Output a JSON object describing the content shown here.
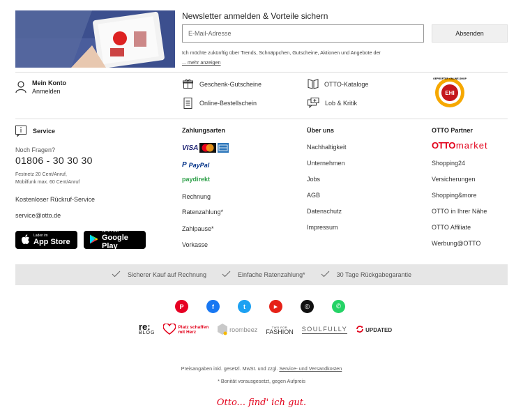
{
  "newsletter": {
    "title": "Newsletter anmelden & Vorteile sichern",
    "email_placeholder": "E-Mail-Adresse",
    "submit_label": "Absenden",
    "consent_text": "Ich möchte zukünftig über Trends, Schnäppchen, Gutscheine, Aktionen und Angebote der",
    "more_label": "... mehr anzeigen"
  },
  "account": {
    "title": "Mein Konto",
    "login": "Anmelden",
    "links": [
      {
        "label": "Geschenk-Gutscheine",
        "icon": "gift-icon"
      },
      {
        "label": "Online-Bestellschein",
        "icon": "document-icon"
      },
      {
        "label": "OTTO-Kataloge",
        "icon": "catalog-icon"
      },
      {
        "label": "Lob & Kritik",
        "icon": "feedback-icon"
      }
    ],
    "seal_text": "GEPRÜFTER ONLINE-SHOP",
    "seal_label": "EHI"
  },
  "service": {
    "title": "Service",
    "question": "Noch Fragen?",
    "phone": "01806 - 30 30 30",
    "cost_line1": "Festnetz 20 Cent/Anruf,",
    "cost_line2": "Mobilfunk max. 60 Cent/Anruf",
    "callback": "Kostenloser Rückruf-Service",
    "email": "service@otto.de",
    "appstore_small": "Laden im",
    "appstore_big": "App Store",
    "googleplay_small": "JETZT BEI",
    "googleplay_big": "Google Play"
  },
  "payment": {
    "title": "Zahlungsarten",
    "visa": "VISA",
    "paypal": "PayPal",
    "paydirekt": "paydirekt",
    "links": [
      "Rechnung",
      "Ratenzahlung*",
      "Zahlpause*",
      "Vorkasse"
    ]
  },
  "about": {
    "title": "Über uns",
    "links": [
      "Nachhaltigkeit",
      "Unternehmen",
      "Jobs",
      "AGB",
      "Datenschutz",
      "Impressum"
    ]
  },
  "partner": {
    "title": "OTTO Partner",
    "market_logo_a": "OTTO",
    "market_logo_b": "market",
    "links": [
      "Shopping24",
      "Versicherungen",
      "Shopping&more",
      "OTTO in Ihrer Nähe",
      "OTTO Affiliate",
      "Werbung@OTTO"
    ]
  },
  "benefits": [
    "Sicherer Kauf auf Rechnung",
    "Einfache Ratenzahlung*",
    "30 Tage Rückgabegarantie"
  ],
  "social": [
    {
      "name": "pinterest-icon",
      "color": "#e60023",
      "glyph": "P"
    },
    {
      "name": "facebook-icon",
      "color": "#1877f2",
      "glyph": "f"
    },
    {
      "name": "twitter-icon",
      "color": "#1da1f2",
      "glyph": "t"
    },
    {
      "name": "youtube-icon",
      "color": "#e62117",
      "glyph": "▶"
    },
    {
      "name": "instagram-icon",
      "color": "#111111",
      "glyph": "◎"
    },
    {
      "name": "whatsapp-icon",
      "color": "#25d366",
      "glyph": "✆"
    }
  ],
  "brands": {
    "reblog_a": "re:",
    "reblog_b": "BLOG",
    "herz_line1": "Platz schaffen",
    "herz_line2": "mit Herz",
    "roombeez": "roombeez",
    "twoforfashion_small": "TWO FOR",
    "twoforfashion_big": "FASHION",
    "soulfully": "SOULFULLY",
    "updated": "UPDATED"
  },
  "footer": {
    "price_note_prefix": "Preisangaben inkl. gesetzl. MwSt. und zzgl.",
    "price_note_link": "Service- und Versandkosten",
    "credit_note": "* Bonität vorausgesetzt, gegen Aufpreis",
    "slogan": "Otto... find' ich gut."
  },
  "colors": {
    "otto_red": "#e2001a",
    "benefits_bg": "#e6e6e6"
  }
}
